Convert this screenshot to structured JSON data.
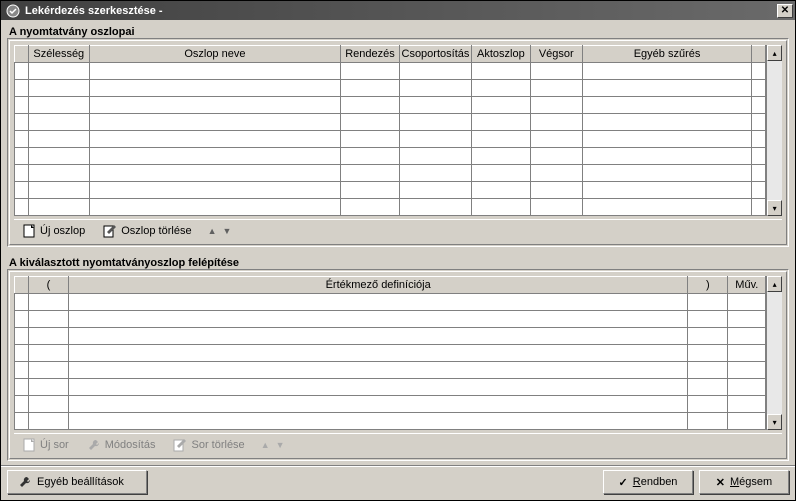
{
  "window": {
    "title": "Lekérdezés szerkesztése -"
  },
  "sectionA": {
    "label": "A nyomtatvány oszlopai",
    "headers": {
      "rowmark": "",
      "width": "Szélesség",
      "colname": "Oszlop neve",
      "sort": "Rendezés",
      "group": "Csoportosítás",
      "actcol": "Aktoszlop",
      "endrow": "Végsor",
      "filter": "Egyéb szűrés",
      "tail": ""
    },
    "toolbar": {
      "newcol": "Új oszlop",
      "delcol": "Oszlop törlése"
    }
  },
  "sectionB": {
    "label": "A kiválasztott nyomtatványoszlop felépítése",
    "headers": {
      "rowmark": "",
      "open": "(",
      "def": "Értékmező definíciója",
      "close": ")",
      "op": "Műv."
    },
    "toolbar": {
      "newrow": "Új sor",
      "modify": "Módosítás",
      "delrow": "Sor törlése"
    }
  },
  "footer": {
    "other": "Egyéb beállítások",
    "ok": "Rendben",
    "cancel": "Mégsem"
  }
}
